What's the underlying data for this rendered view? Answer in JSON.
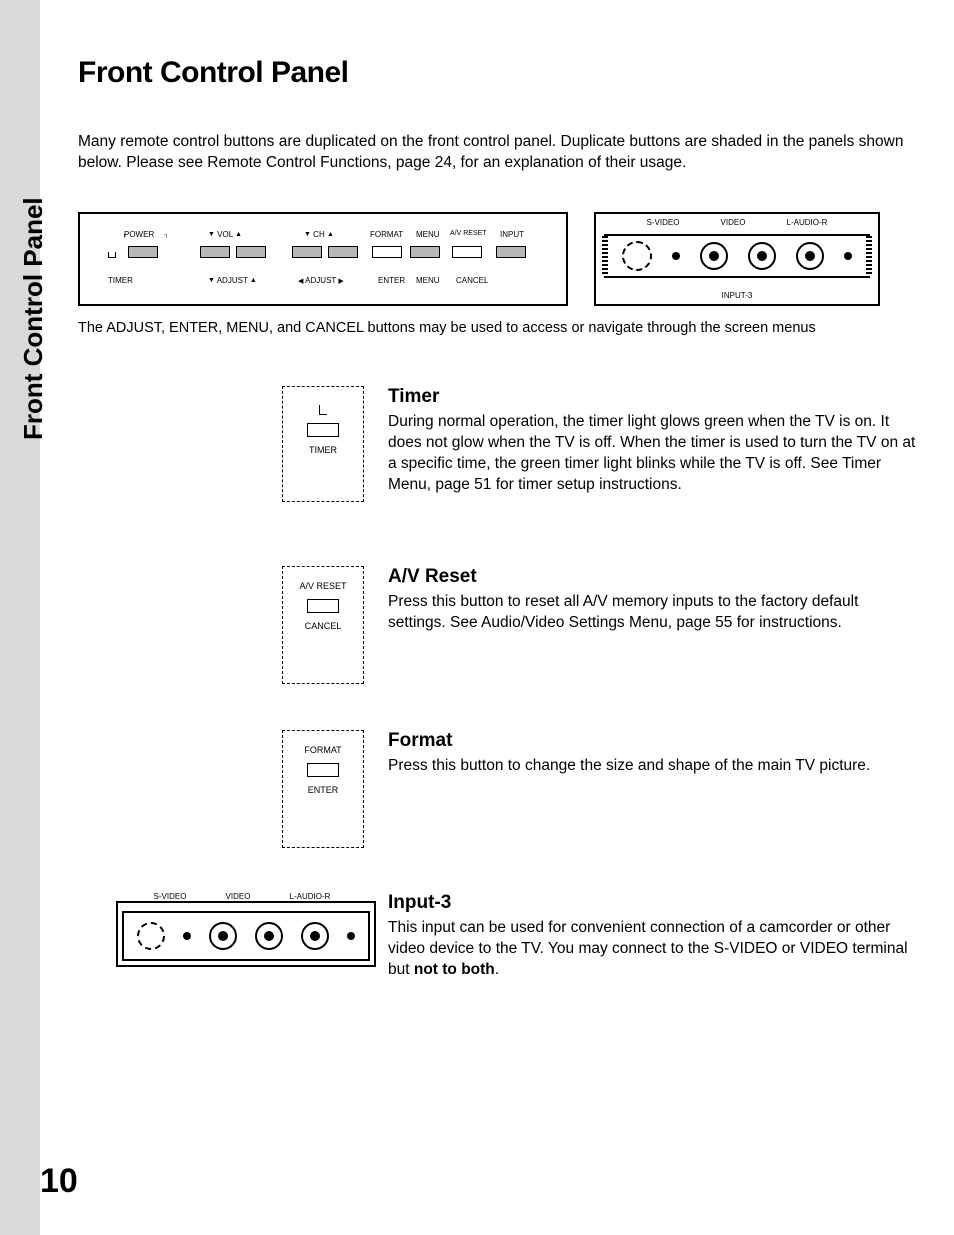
{
  "title": "Front Control Panel",
  "side_tab": "Front Control Panel",
  "intro": "Many remote control buttons are duplicated on the front control panel.  Duplicate buttons are shaded in the panels shown below.  Please see Remote Control Functions, page 24, for an explanation of their usage.",
  "panel": {
    "row1": {
      "power": "POWER",
      "vol": "VOL",
      "ch": "CH",
      "format": "FORMAT",
      "menu": "MENU",
      "avreset": "A/V RESET",
      "input": "INPUT"
    },
    "row2": {
      "timer": "TIMER",
      "adjust": "ADJUST",
      "adjust2": "ADJUST",
      "enter": "ENTER",
      "menu": "MENU",
      "cancel": "CANCEL"
    },
    "jacks": {
      "svideo": "S-VIDEO",
      "video": "VIDEO",
      "laudior": "L-AUDIO-R",
      "input3": "INPUT-3"
    }
  },
  "caption": "The ADJUST, ENTER, MENU, and CANCEL buttons may be used to access or navigate through the screen menus",
  "timer": {
    "heading": "Timer",
    "timer_label": "TIMER",
    "body": "During normal operation, the timer light glows green when the TV is on.  It does not glow when the TV is off.  When the timer is used to turn the TV on at a specific time, the green timer light blinks while the TV is off.  See Timer Menu, page 51 for timer setup instructions."
  },
  "avreset": {
    "heading": "A/V Reset",
    "top_label": "A/V RESET",
    "bottom_label": "CANCEL",
    "body": "Press this button to reset all A/V memory inputs to the factory default settings.  See Audio/Video Settings Menu, page 55 for instructions."
  },
  "format": {
    "heading": "Format",
    "top_label": "FORMAT",
    "bottom_label": "ENTER",
    "body": "Press this button to change the size and shape of the main TV picture."
  },
  "input3": {
    "heading": "Input-3",
    "svideo": "S-VIDEO",
    "video": "VIDEO",
    "laudior": "L-AUDIO-R",
    "body_pre": "This input can be used for convenient connection of a camcorder or other video device to the TV.  You may connect to the S-VIDEO or VIDEO terminal but ",
    "body_bold": "not to both",
    "body_post": "."
  },
  "page_number": "10"
}
